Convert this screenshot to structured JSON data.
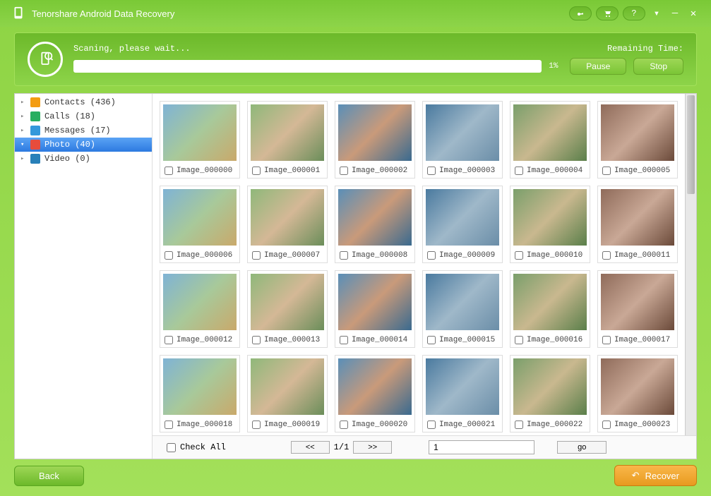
{
  "app": {
    "title": "Tenorshare Android Data Recovery"
  },
  "scan": {
    "status": "Scaning, please wait...",
    "remaining_label": "Remaining Time:",
    "percent": "1%",
    "pause": "Pause",
    "stop": "Stop"
  },
  "sidebar": {
    "items": [
      {
        "label": "Contacts (436)",
        "icon_bg": "#f39c12",
        "chevron": "▸"
      },
      {
        "label": "Calls (18)",
        "icon_bg": "#27ae60",
        "chevron": "▸"
      },
      {
        "label": "Messages (17)",
        "icon_bg": "#3498db",
        "chevron": "▸"
      },
      {
        "label": "Photo (40)",
        "icon_bg": "#e74c3c",
        "chevron": "▾",
        "selected": true
      },
      {
        "label": "Video (0)",
        "icon_bg": "#2980b9",
        "chevron": "▸"
      }
    ]
  },
  "photos": [
    "Image_000000",
    "Image_000001",
    "Image_000002",
    "Image_000003",
    "Image_000004",
    "Image_000005",
    "Image_000006",
    "Image_000007",
    "Image_000008",
    "Image_000009",
    "Image_000010",
    "Image_000011",
    "Image_000012",
    "Image_000013",
    "Image_000014",
    "Image_000015",
    "Image_000016",
    "Image_000017",
    "Image_000018",
    "Image_000019",
    "Image_000020",
    "Image_000021",
    "Image_000022",
    "Image_000023"
  ],
  "bottom": {
    "check_all": "Check All",
    "page_display": "1/1",
    "page_input": "1",
    "go": "go",
    "prev": "<<",
    "next": ">>"
  },
  "footer": {
    "back": "Back",
    "recover": "Recover"
  }
}
